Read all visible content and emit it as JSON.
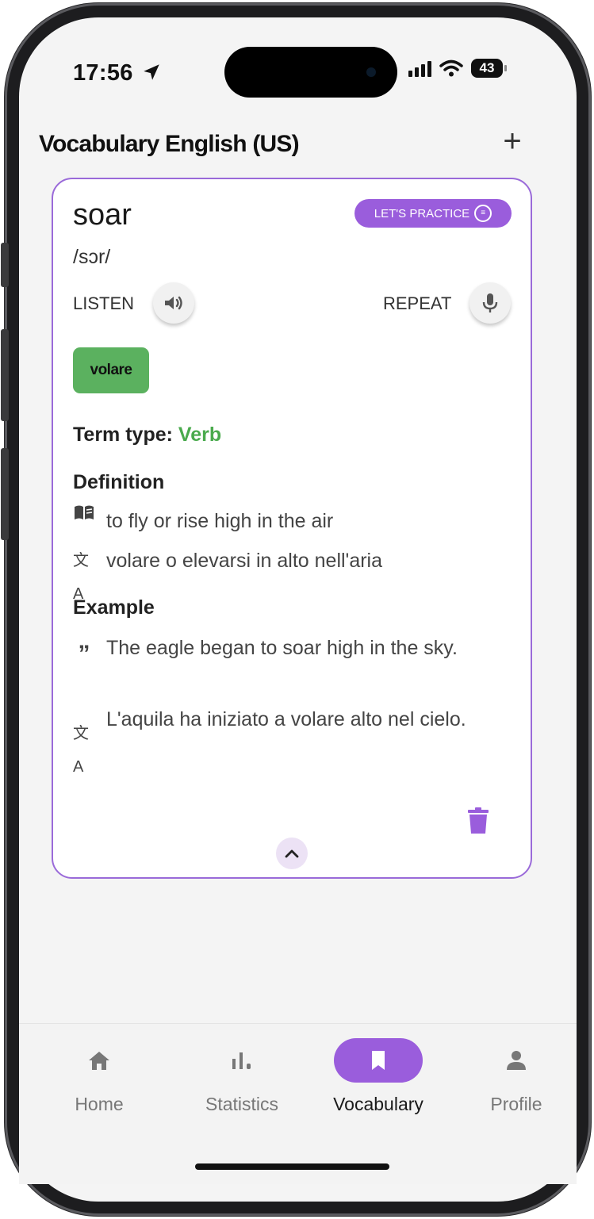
{
  "status_bar": {
    "time": "17:56",
    "battery": "43"
  },
  "header": {
    "title": "Vocabulary English (US)",
    "add_label": "+"
  },
  "card": {
    "term": "soar",
    "practice_label": "LET'S PRACTICE",
    "phonetic": "/sɔr/",
    "listen_label": "LISTEN",
    "repeat_label": "REPEAT",
    "translation": "volare",
    "term_type_label": "Term type:",
    "term_type_value": "Verb",
    "definition_title": "Definition",
    "definition_en": "to fly or rise high in the air",
    "definition_tr": "volare o elevarsi in alto nell'aria",
    "example_title": "Example",
    "example_en": "The eagle began to soar high in the sky.",
    "example_tr": "L'aquila ha iniziato a volare alto nel cielo."
  },
  "nav": {
    "items": [
      {
        "label": "Home",
        "icon": "home-icon",
        "active": false
      },
      {
        "label": "Statistics",
        "icon": "bar-chart-icon",
        "active": false
      },
      {
        "label": "Vocabulary",
        "icon": "bookmark-icon",
        "active": true
      },
      {
        "label": "Profile",
        "icon": "person-icon",
        "active": false
      }
    ]
  },
  "colors": {
    "accent": "#9a5ddc",
    "green": "#5bb15f",
    "verb": "#4aaa4d"
  }
}
